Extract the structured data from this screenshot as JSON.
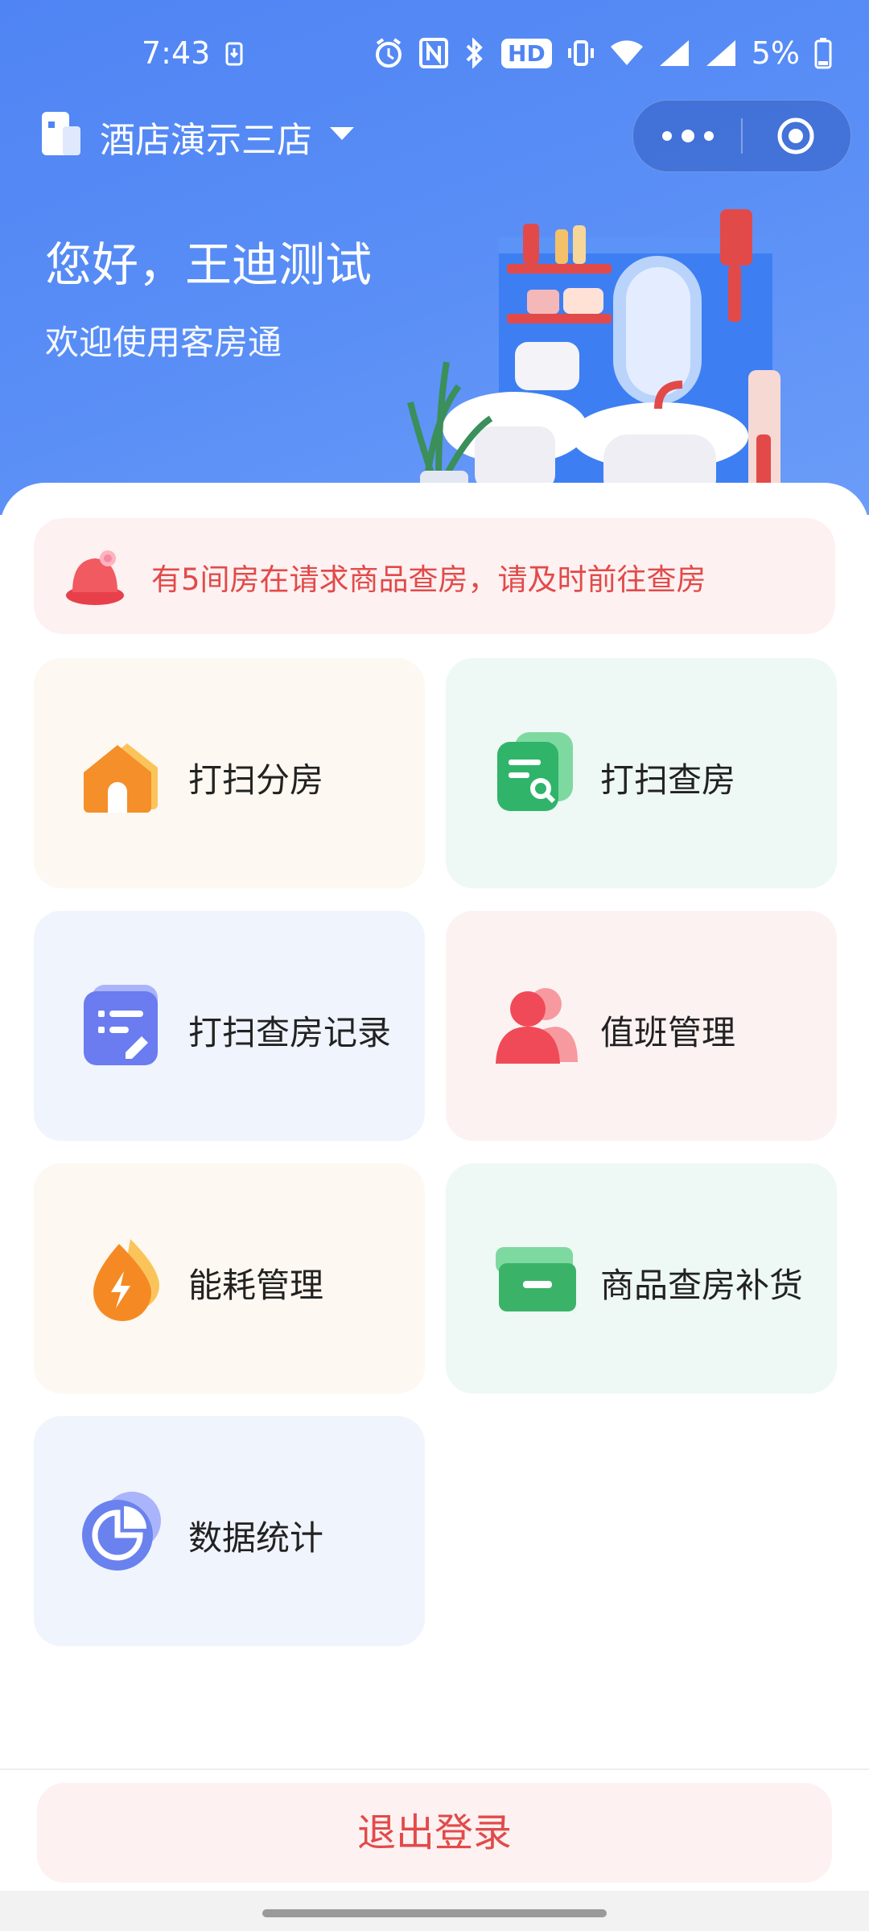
{
  "status_bar": {
    "time": "7:43",
    "hd_label": "HD",
    "battery": "5%"
  },
  "header": {
    "store_name": "酒店演示三店",
    "greeting": "您好，王迪测试",
    "subtitle": "欢迎使用客房通"
  },
  "notice": {
    "text": "有5间房在请求商品查房，请及时前往查房"
  },
  "menu": {
    "items": [
      {
        "label": "打扫分房",
        "icon": "house-icon",
        "color": "#f59a2a"
      },
      {
        "label": "打扫查房",
        "icon": "document-search-icon",
        "color": "#2fb46a"
      },
      {
        "label": "打扫查房记录",
        "icon": "notepad-edit-icon",
        "color": "#6a7cf0"
      },
      {
        "label": "值班管理",
        "icon": "users-icon",
        "color": "#f04a58"
      },
      {
        "label": "能耗管理",
        "icon": "energy-drop-icon",
        "color": "#f58a24"
      },
      {
        "label": "商品查房补货",
        "icon": "box-icon",
        "color": "#3ab368"
      },
      {
        "label": "数据统计",
        "icon": "pie-chart-icon",
        "color": "#6a82ee"
      }
    ]
  },
  "footer": {
    "logout_label": "退出登录"
  },
  "colors": {
    "header_blue": "#4f84f4",
    "alert_red": "#e24a4a"
  }
}
